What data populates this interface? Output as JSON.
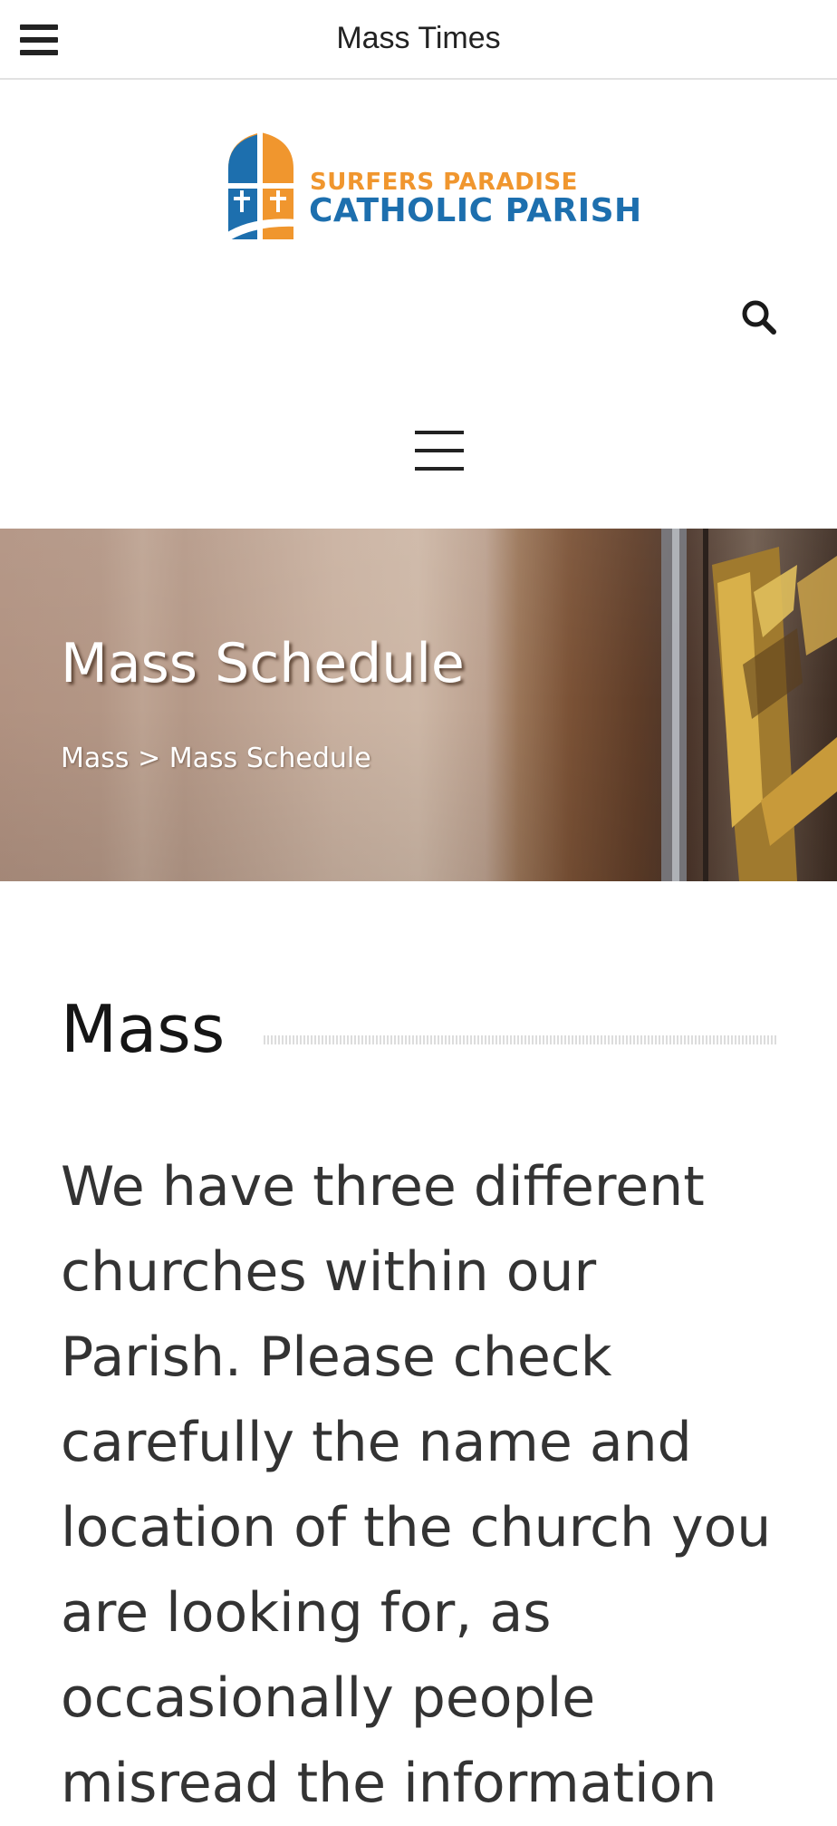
{
  "topbar": {
    "title": "Mass Times",
    "menu_icon": "hamburger-icon"
  },
  "logo": {
    "line1": "SURFERS PARADISE",
    "line2": "CATHOLIC PARISH",
    "colors": {
      "orange": "#f0962e",
      "blue": "#1d6fae"
    }
  },
  "search": {
    "icon": "search-icon"
  },
  "nav": {
    "icon": "menu-icon"
  },
  "hero": {
    "title": "Mass Schedule",
    "breadcrumb": {
      "parent": "Mass",
      "separator": ">",
      "current": "Mass Schedule"
    }
  },
  "content": {
    "heading": "Mass",
    "intro": "We have three different churches within our Parish. Please check carefully the name and location of the church you are looking for, as occasionally people misread the information"
  }
}
